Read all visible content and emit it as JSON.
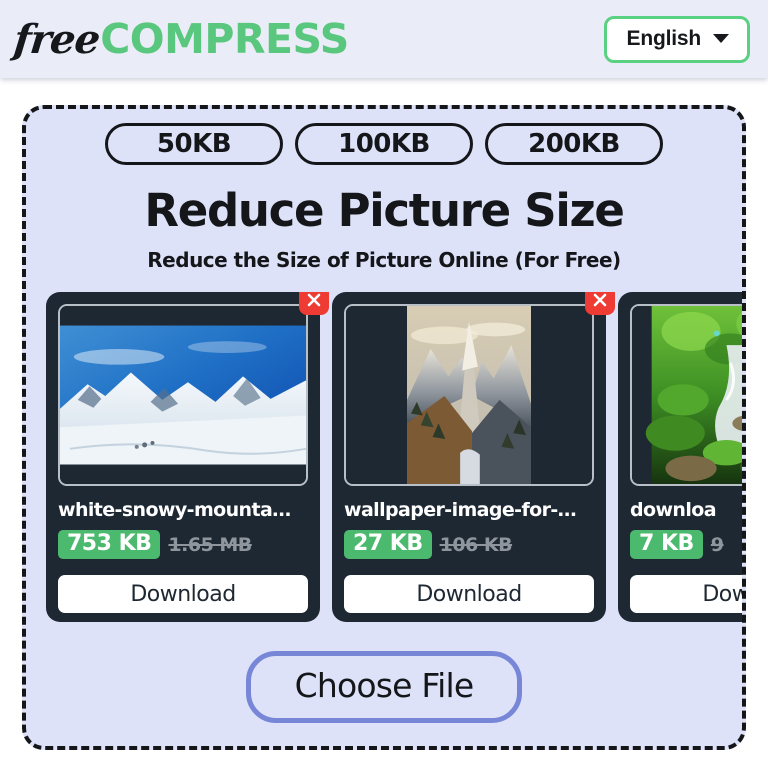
{
  "header": {
    "logo_free": "free",
    "logo_compress": "COMPRESS",
    "language_label": "English"
  },
  "size_presets": [
    {
      "label": "50KB"
    },
    {
      "label": "100KB"
    },
    {
      "label": "200KB"
    }
  ],
  "hero": {
    "title": "Reduce Picture Size",
    "subtitle": "Reduce the Size of Picture Online (For Free)"
  },
  "cards": [
    {
      "file_name": "white-snowy-mounta…",
      "new_size": "753 KB",
      "old_size": "1.65 MB",
      "download_label": "Download",
      "thumb": "snowy-mountain-photo"
    },
    {
      "file_name": "wallpaper-image-for-…",
      "new_size": "27 KB",
      "old_size": "106 KB",
      "download_label": "Download",
      "thumb": "grey-mountain-valley-photo"
    },
    {
      "file_name": "downloa",
      "new_size": "7 KB",
      "old_size": "9",
      "download_label": "Download",
      "thumb": "green-forest-stream-photo"
    }
  ],
  "choose_file": {
    "label": "Choose File"
  },
  "colors": {
    "brand_green": "#5ac77e",
    "badge_green": "#4cba6e",
    "card_dark": "#1e2833",
    "dropzone_bg": "#dde2f8",
    "header_bg": "#eaedf7",
    "close_red": "#ee3b33",
    "choose_border": "#7886d8"
  }
}
